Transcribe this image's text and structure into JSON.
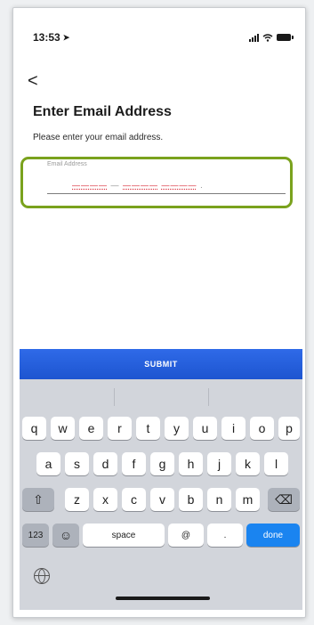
{
  "status": {
    "time": "13:53"
  },
  "nav": {
    "back": "<"
  },
  "page": {
    "title": "Enter Email Address",
    "subtitle": "Please enter your email address."
  },
  "field": {
    "label": "Email Address",
    "value_segments": [
      "————",
      "—",
      "————",
      "————",
      "."
    ]
  },
  "submit_label": "SUBMIT",
  "keyboard": {
    "row1": [
      "q",
      "w",
      "e",
      "r",
      "t",
      "y",
      "u",
      "i",
      "o",
      "p"
    ],
    "row2": [
      "a",
      "s",
      "d",
      "f",
      "g",
      "h",
      "j",
      "k",
      "l"
    ],
    "row3": [
      "z",
      "x",
      "c",
      "v",
      "b",
      "n",
      "m"
    ],
    "shift_icon": "⇧",
    "backspace_icon": "⌫",
    "numbers": "123",
    "emoji_icon": "☺",
    "space": "space",
    "at": "@",
    "dot": ".",
    "done": "done"
  }
}
